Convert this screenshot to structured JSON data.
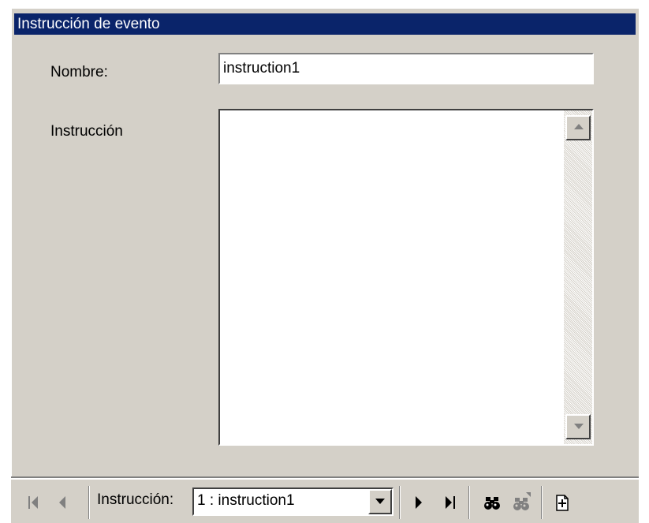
{
  "window": {
    "title": "Instrucción de evento"
  },
  "form": {
    "name_label": "Nombre:",
    "name_value": "instruction1",
    "instruction_label": "Instrucción",
    "instruction_value": ""
  },
  "navigator": {
    "label": "Instrucción:",
    "selected": "1 : instruction1",
    "buttons": {
      "first": "first-record-icon",
      "previous": "previous-record-icon",
      "next": "next-record-icon",
      "last": "last-record-icon",
      "find": "binoculars-icon",
      "find_next": "binoculars-next-icon",
      "new": "new-record-icon"
    }
  },
  "colors": {
    "titlebar": "#0a246a",
    "dialog_face": "#d4d0c8",
    "disabled_icon": "#808080"
  }
}
